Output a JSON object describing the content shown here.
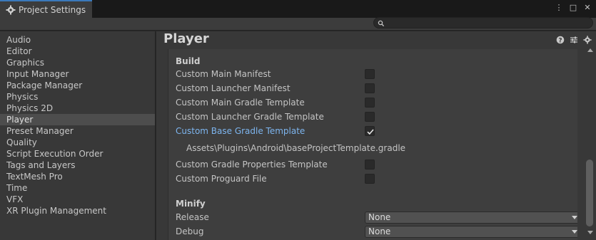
{
  "window": {
    "tab_title": "Project Settings",
    "tab_icon": "gear-icon",
    "actions": [
      "more-options-icon",
      "maximize-icon",
      "close-icon"
    ]
  },
  "search": {
    "value": "",
    "placeholder": ""
  },
  "sidebar": {
    "items": [
      {
        "label": "Audio"
      },
      {
        "label": "Editor"
      },
      {
        "label": "Graphics"
      },
      {
        "label": "Input Manager"
      },
      {
        "label": "Package Manager"
      },
      {
        "label": "Physics"
      },
      {
        "label": "Physics 2D"
      },
      {
        "label": "Player",
        "selected": true
      },
      {
        "label": "Preset Manager"
      },
      {
        "label": "Quality"
      },
      {
        "label": "Script Execution Order"
      },
      {
        "label": "Tags and Layers"
      },
      {
        "label": "TextMesh Pro"
      },
      {
        "label": "Time"
      },
      {
        "label": "VFX"
      },
      {
        "label": "XR Plugin Management"
      }
    ]
  },
  "main": {
    "title": "Player",
    "header_icons": [
      "help-icon",
      "presets-icon",
      "settings-icon"
    ],
    "build": {
      "title": "Build",
      "rows": [
        {
          "label": "Custom Main Manifest",
          "checked": false
        },
        {
          "label": "Custom Launcher Manifest",
          "checked": false
        },
        {
          "label": "Custom Main Gradle Template",
          "checked": false
        },
        {
          "label": "Custom Launcher Gradle Template",
          "checked": false
        },
        {
          "label": "Custom Base Gradle Template",
          "checked": true
        }
      ],
      "path": "Assets\\Plugins\\Android\\baseProjectTemplate.gradle",
      "rows2": [
        {
          "label": "Custom Gradle Properties Template",
          "checked": false
        },
        {
          "label": "Custom Proguard File",
          "checked": false
        }
      ]
    },
    "minify": {
      "title": "Minify",
      "release_label": "Release",
      "release_value": "None",
      "debug_label": "Debug",
      "debug_value": "None"
    }
  },
  "colors": {
    "accent": "#3a79bb",
    "highlight_text": "#7db5ef",
    "selected_row": "#4d4d4d"
  }
}
